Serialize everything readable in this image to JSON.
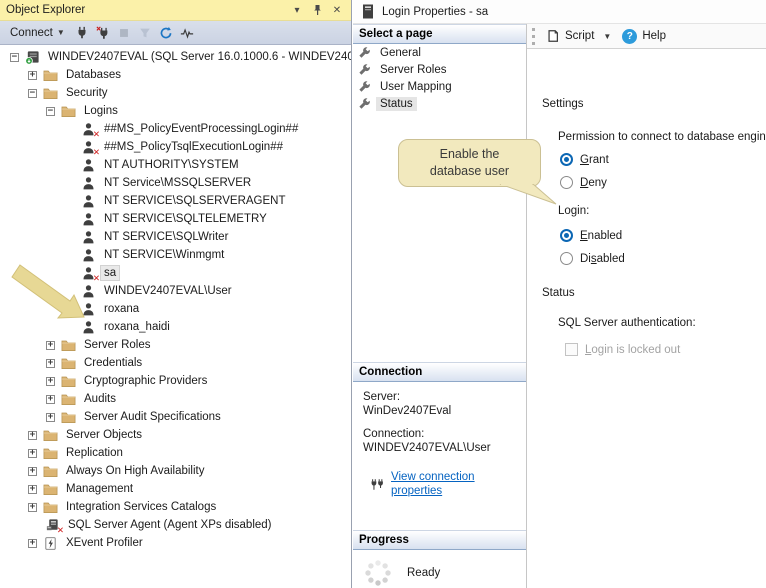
{
  "object_explorer": {
    "title": "Object Explorer",
    "toolbar": {
      "connect_label": "Connect"
    },
    "tree": [
      {
        "label": "WINDEV2407EVAL (SQL Server 16.0.1000.6 - WINDEV2407EV",
        "level": 0,
        "icon": "server",
        "expander": "minus"
      },
      {
        "label": "Databases",
        "level": 1,
        "icon": "folder",
        "expander": "plus"
      },
      {
        "label": "Security",
        "level": 1,
        "icon": "folder",
        "expander": "minus"
      },
      {
        "label": "Logins",
        "level": 2,
        "icon": "folder",
        "expander": "minus"
      },
      {
        "label": "##MS_PolicyEventProcessingLogin##",
        "level": 3,
        "icon": "user",
        "disabled_badge": true
      },
      {
        "label": "##MS_PolicyTsqlExecutionLogin##",
        "level": 3,
        "icon": "user",
        "disabled_badge": true
      },
      {
        "label": "NT AUTHORITY\\SYSTEM",
        "level": 3,
        "icon": "user"
      },
      {
        "label": "NT Service\\MSSQLSERVER",
        "level": 3,
        "icon": "user"
      },
      {
        "label": "NT SERVICE\\SQLSERVERAGENT",
        "level": 3,
        "icon": "user"
      },
      {
        "label": "NT SERVICE\\SQLTELEMETRY",
        "level": 3,
        "icon": "user"
      },
      {
        "label": "NT SERVICE\\SQLWriter",
        "level": 3,
        "icon": "user"
      },
      {
        "label": "NT SERVICE\\Winmgmt",
        "level": 3,
        "icon": "user"
      },
      {
        "label": "sa",
        "level": 3,
        "icon": "user",
        "disabled_badge": true,
        "selected": true
      },
      {
        "label": "WINDEV2407EVAL\\User",
        "level": 3,
        "icon": "user"
      },
      {
        "label": "roxana",
        "level": 3,
        "icon": "user"
      },
      {
        "label": "roxana_haidi",
        "level": 3,
        "icon": "user"
      },
      {
        "label": "Server Roles",
        "level": 2,
        "icon": "folder",
        "expander": "plus"
      },
      {
        "label": "Credentials",
        "level": 2,
        "icon": "folder",
        "expander": "plus"
      },
      {
        "label": "Cryptographic Providers",
        "level": 2,
        "icon": "folder",
        "expander": "plus"
      },
      {
        "label": "Audits",
        "level": 2,
        "icon": "folder",
        "expander": "plus"
      },
      {
        "label": "Server Audit Specifications",
        "level": 2,
        "icon": "folder",
        "expander": "plus"
      },
      {
        "label": "Server Objects",
        "level": 1,
        "icon": "folder",
        "expander": "plus"
      },
      {
        "label": "Replication",
        "level": 1,
        "icon": "folder",
        "expander": "plus"
      },
      {
        "label": "Always On High Availability",
        "level": 1,
        "icon": "folder",
        "expander": "plus"
      },
      {
        "label": "Management",
        "level": 1,
        "icon": "folder",
        "expander": "plus"
      },
      {
        "label": "Integration Services Catalogs",
        "level": 1,
        "icon": "folder",
        "expander": "plus"
      },
      {
        "label": "SQL Server Agent (Agent XPs disabled)",
        "level": 1,
        "icon": "agent",
        "disabled_badge": true
      },
      {
        "label": "XEvent Profiler",
        "level": 1,
        "icon": "xevent",
        "expander": "plus"
      }
    ]
  },
  "dialog": {
    "title": "Login Properties - sa",
    "pages": {
      "header": "Select a page",
      "items": [
        {
          "label": "General"
        },
        {
          "label": "Server Roles"
        },
        {
          "label": "User Mapping"
        },
        {
          "label": "Status",
          "selected": true
        }
      ]
    },
    "toolbar": {
      "script_label": "Script",
      "help_label": "Help"
    },
    "settings": {
      "section": "Settings",
      "permission_label": "Permission to connect to database engine:",
      "grant": {
        "text": "Grant",
        "accel": 0,
        "selected": true
      },
      "deny": {
        "text": "Deny",
        "accel": 0,
        "selected": false
      },
      "login_label": "Login:",
      "enabled": {
        "text": "Enabled",
        "accel": 0,
        "selected": true
      },
      "disabled": {
        "text": "Disabled",
        "accel": 2,
        "selected": false
      },
      "status_section": "Status",
      "sql_auth_label": "SQL Server authentication:",
      "locked_out": {
        "text": "Login is locked out",
        "accel": 0,
        "checked": false,
        "disabled": true
      }
    },
    "connection": {
      "header": "Connection",
      "server_label": "Server:",
      "server_value": "WinDev2407Eval",
      "connection_label": "Connection:",
      "connection_value": "WINDEV2407EVAL\\User",
      "link_label": "View connection properties"
    },
    "progress": {
      "header": "Progress",
      "status": "Ready"
    }
  },
  "annotations": {
    "callout_line1": "Enable the",
    "callout_line2": "database user"
  },
  "colors": {
    "accent_blue": "#0c67b4",
    "link_blue": "#0563c1",
    "title_bar_yellow": "#fbf1a9",
    "toolbar_blue_gray": "#cbd3e3",
    "folder_tan": "#dbb472",
    "callout_bg": "#f2e9be",
    "arrow_fill": "#e7d895",
    "disabled_red": "#ce1b1b"
  }
}
